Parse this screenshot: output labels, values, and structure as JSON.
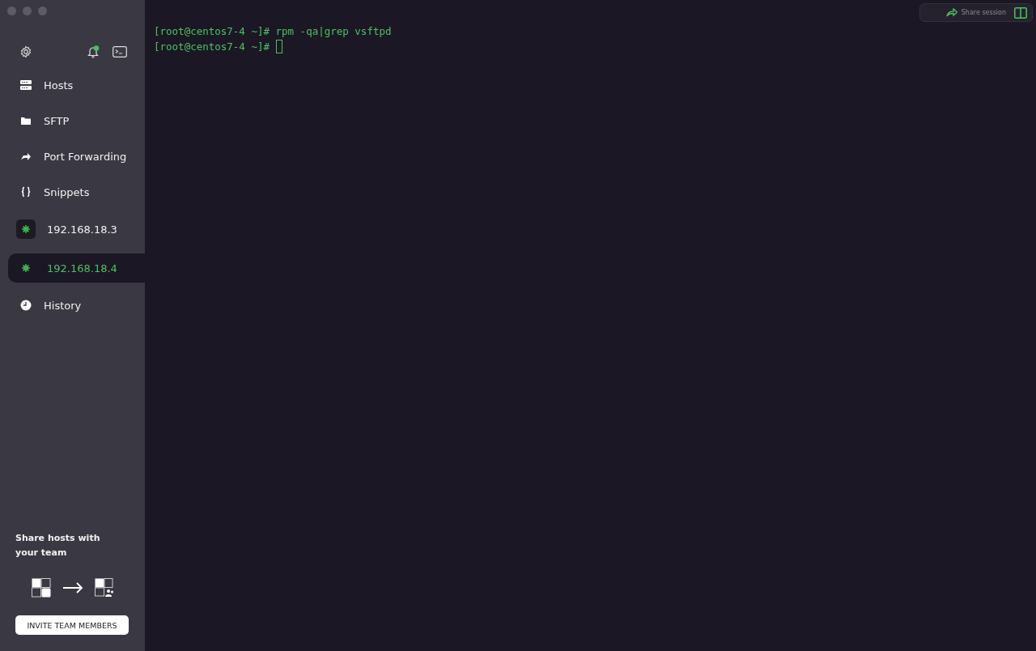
{
  "sidebar": {
    "items": [
      {
        "label": "Hosts",
        "kind": "nav",
        "selected": false
      },
      {
        "label": "SFTP",
        "kind": "nav",
        "selected": false
      },
      {
        "label": "Port Forwarding",
        "kind": "nav",
        "selected": false
      },
      {
        "label": "Snippets",
        "kind": "nav",
        "selected": false
      },
      {
        "label": "192.168.18.3",
        "kind": "host",
        "selected": false
      },
      {
        "label": "192.168.18.4",
        "kind": "host",
        "selected": true
      },
      {
        "label": "History",
        "kind": "nav",
        "selected": false
      }
    ],
    "promo": {
      "title": "Share hosts with your team",
      "button": "INVITE TEAM MEMBERS"
    },
    "notification": {
      "unread": true
    }
  },
  "toolbar": {
    "share_label": "Share session"
  },
  "terminal": {
    "lines": [
      {
        "prompt": "[root@centos7-4 ~]#",
        "command": "rpm -qa|grep vsftpd",
        "cursor": false
      },
      {
        "prompt": "[root@centos7-4 ~]#",
        "cursor": true
      }
    ]
  }
}
